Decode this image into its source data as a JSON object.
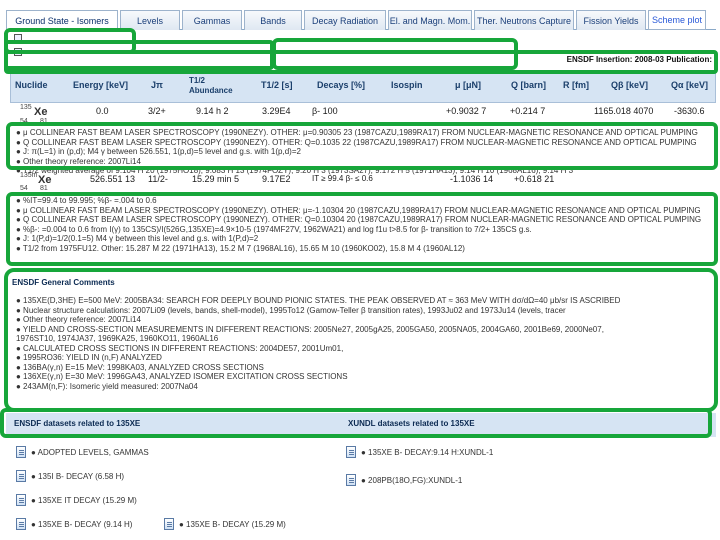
{
  "tabs": [
    {
      "label": "Ground State - Isomers",
      "active": true
    },
    {
      "label": "Levels"
    },
    {
      "label": "Gammas"
    },
    {
      "label": "Bands"
    },
    {
      "label": "Decay Radiation"
    },
    {
      "label": "El. and Magn. Mom."
    },
    {
      "label": "Ther. Neutrons Capture"
    },
    {
      "label": "Fission Yields"
    },
    {
      "label": "Scheme plot"
    }
  ],
  "info_bar": "ENSDF Insertion: 2008-03  Publication:",
  "table": {
    "headers": [
      "Nuclide",
      "Energy [keV]",
      "Jπ",
      "T1/2 Abundance",
      "T1/2 [s]",
      "Decays [%]",
      "Isospin",
      "μ [μN]",
      "Q [barn]",
      "R [fm]",
      "Qβ [keV]",
      "Qα [keV]"
    ],
    "rows": [
      {
        "mass": "135",
        "sym": "Xe",
        "z": "54",
        "n": "81",
        "energy": "0.0",
        "jpi": "3/2+",
        "t_half": "9.14 h 2",
        "t_half_s": "3.29E4",
        "decay": "β-  100",
        "mu": "+0.9032 7",
        "q": "+0.214 7",
        "qb": "1165.018 4070",
        "qa": "-3630.6"
      },
      {
        "mass": "135m",
        "sym": "Xe",
        "z": "54",
        "n": "81",
        "energy": "526.551 13",
        "jpi": "11/2-",
        "t_half": "15.29 min 5",
        "t_half_s": "9.17E2",
        "decay": "IT ≥ 99.4  β- ≤ 0.6",
        "mu": "-1.1036 14",
        "q": "+0.618 21",
        "qb": "",
        "qa": ""
      }
    ]
  },
  "comments1": [
    "● μ COLLINEAR FAST BEAM LASER SPECTROSCOPY (1990NEZY). OTHER: μ=0.90305 23 (1987CAZU,1989RA17) FROM NUCLEAR-MAGNETIC RESONANCE AND OPTICAL PUMPING",
    "● Q COLLINEAR FAST BEAM LASER SPECTROSCOPY (1990NEZY). OTHER: Q=0.1035 22 (1987CAZU,1989RA17) FROM NUCLEAR-MAGNETIC RESONANCE AND OPTICAL PUMPING",
    "● J: π(L=1) in (p,d); M4 γ between 526.551, 1(p,d)=5 level and g.s. with 1(p,d)=2",
    "● Other theory reference: 2007Li14",
    "● T1/2 weighted average of 9.104 H 20 (1975HO18), 9.083 H 13 (1974FOZY), 9.20 H 3 (1973SA27), 9.172 H 5 (1971HA13), 9.14 H 10 (1968AL16), 9.14 H 3"
  ],
  "comments2": [
    "● %IT=99.4 to 99.995; %β- =.004 to 0.6",
    "● μ COLLINEAR FAST BEAM LASER SPECTROSCOPY (1990NEZY). OTHER: μ=-1.10304 20 (1987CAZU,1989RA17) FROM NUCLEAR-MAGNETIC RESONANCE AND OPTICAL PUMPING",
    "● Q COLLINEAR FAST BEAM LASER SPECTROSCOPY (1990NEZY). OTHER: Q=0.10304 20 (1987CAZU,1989RA17) FROM NUCLEAR-MAGNETIC RESONANCE AND OPTICAL PUMPING",
    "● %β-: =0.004 to 0.6 from I(γ) to 135CS)/I(526G,135XE)=4.9×10-5 (1974MF27V, 1962WA21) and log f1u t>8.5 for β- transition to 7/2+ 135CS g.s.",
    "● J: 1(P,d)=1/2(0.1=5) M4 γ between this level and g.s. with 1(P,d)=2",
    "● T1/2 from 1975FU12. Other: 15.287 M 22 (1971HA13), 15.2 M 7 (1968AL16), 15.65 M 10 (1960KO02), 15.8 M 4 (1960AL12)"
  ],
  "general_title": "ENSDF General Comments",
  "general_comments": [
    "● 135XE(D,3HE) E=500 MeV: 2005BA34: SEARCH FOR DEEPLY BOUND PIONIC STATES. THE PEAK OBSERVED AT ≈ 363 MeV WITH dσ/dΩ=40 μb/sr IS ASCRIBED",
    "● Nuclear structure calculations: 2007Li09 (levels, bands, shell-model), 1995To12 (Gamow-Teller β transition rates), 1993Ju02 and 1973Ju14 (levels, tracer",
    "● Other theory reference: 2007Li14",
    "● YIELD AND CROSS-SECTION MEASUREMENTS IN DIFFERENT REACTIONS: 2005Ne27, 2005gA25, 2005GA50, 2005NA05, 2004GA60, 2001Be69, 2000Ne07,",
    "1976ST10, 1974JA37, 1969KA25, 1960KO11, 1960AL16",
    "● CALCULATED CROSS SECTIONS IN DIFFERENT REACTIONS: 2004DE57, 2001Um01,",
    "● 1995RO36: YIELD IN (n,F) ANALYZED",
    "● 136BA(γ,n) E=15 MeV: 1998KA03, ANALYZED CROSS SECTIONS",
    "● 136XE(γ,n) E=30 MeV: 1996GA43, ANALYZED ISOMER EXCITATION CROSS SECTIONS",
    "● 243AM(n,F): Isomeric yield measured: 2007Na04"
  ],
  "datasets_left_title": "ENSDF datasets related to 135XE",
  "datasets_right_title": "XUNDL datasets related to 135XE",
  "datasets_left": [
    "● ADOPTED LEVELS, GAMMAS",
    "● 135I B- DECAY (6.58 H)",
    "● 135XE IT DECAY (15.29 M)"
  ],
  "datasets_left_extra": [
    "● 135XE B- DECAY (9.14 H)",
    "● 135XE B- DECAY (15.29 M)"
  ],
  "datasets_right": [
    "● 135XE B- DECAY:9.14 H:XUNDL-1",
    "● 208PB(18O,FG):XUNDL-1"
  ],
  "colors": {
    "frame": "#17a63a",
    "header_bg": "#d6e4f3",
    "link": "#1a3f7a"
  }
}
